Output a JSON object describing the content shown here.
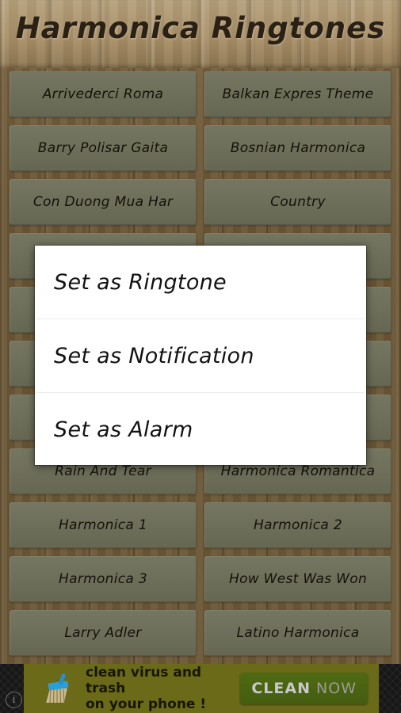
{
  "app": {
    "title": "Harmonica Ringtones"
  },
  "ringtones": {
    "rows": [
      [
        "Arrivederci Roma",
        "Balkan Expres Theme"
      ],
      [
        "Barry Polisar Gaita",
        "Bosnian Harmonica"
      ],
      [
        "Con Duong Mua Har",
        "Country"
      ],
      [
        "",
        ""
      ],
      [
        "",
        ""
      ],
      [
        "",
        ""
      ],
      [
        "",
        ""
      ],
      [
        "Rain And Tear",
        "Harmonica Romantica"
      ],
      [
        "Harmonica 1",
        "Harmonica 2"
      ],
      [
        "Harmonica 3",
        "How West Was Won"
      ],
      [
        "Larry Adler",
        "Latino Harmonica"
      ]
    ]
  },
  "dialog": {
    "options": [
      "Set as Ringtone",
      "Set as Notification",
      "Set as Alarm"
    ]
  },
  "ad": {
    "info_icon": "i",
    "icon_name": "broom-icon",
    "line1": "clean virus and trash",
    "line2": "on your phone !",
    "cta_strong": "CLEAN",
    "cta_light": "NOW"
  },
  "colors": {
    "wood": "#6c5836",
    "header_wood": "#ab9470",
    "button": "#6e6f5a",
    "dialog_bg": "#ffffff",
    "ad_bg": "#6b6a18",
    "ad_cta": "#4a6412"
  }
}
